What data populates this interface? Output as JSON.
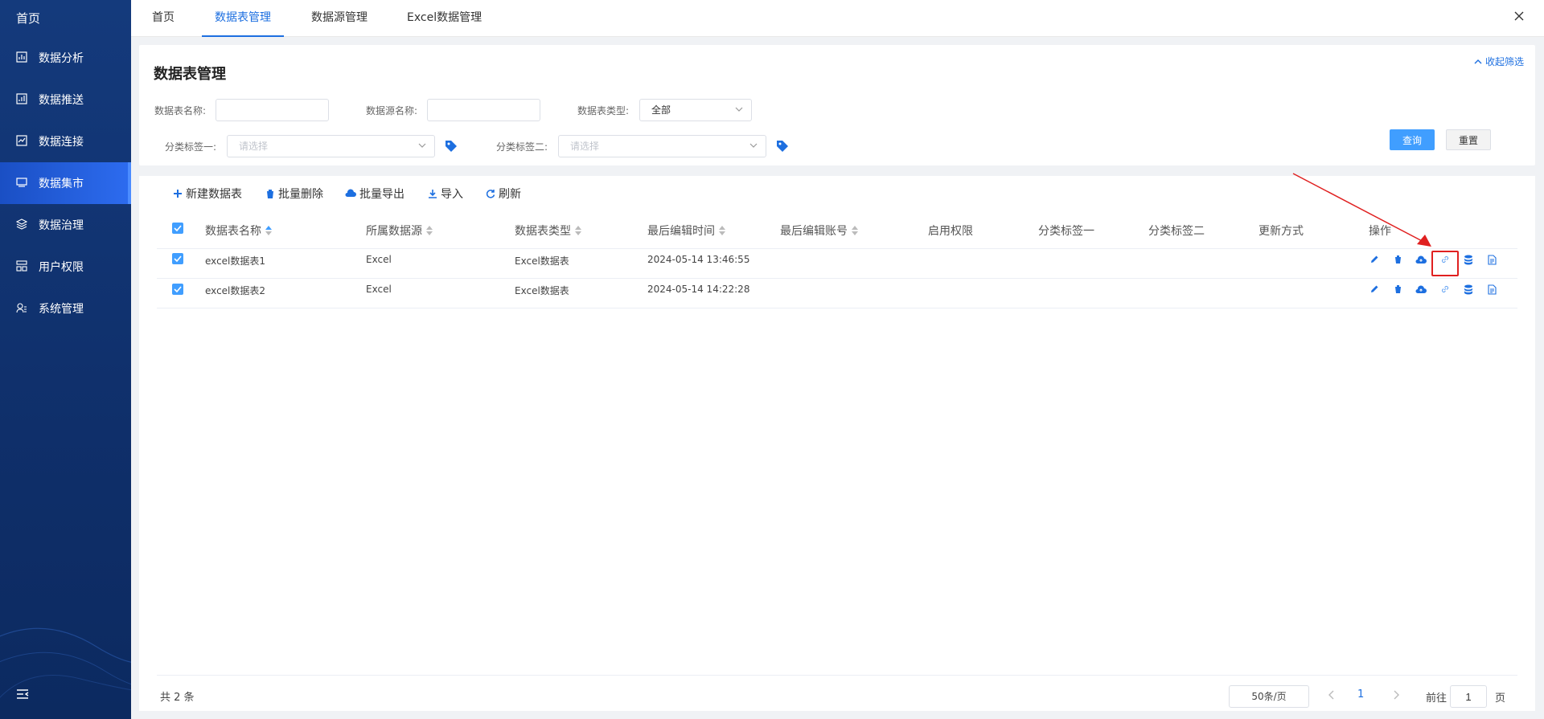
{
  "sidebar": {
    "home": "首页",
    "items": [
      {
        "label": "数据分析",
        "icon": "chart-icon"
      },
      {
        "label": "数据推送",
        "icon": "push-icon"
      },
      {
        "label": "数据连接",
        "icon": "connect-icon"
      },
      {
        "label": "数据集市",
        "icon": "monitor-icon",
        "active": true
      },
      {
        "label": "数据治理",
        "icon": "layers-icon"
      },
      {
        "label": "用户权限",
        "icon": "user-permission-icon"
      },
      {
        "label": "系统管理",
        "icon": "settings-icon"
      }
    ],
    "toggle_icon": "menu-collapse-icon"
  },
  "tabs": [
    {
      "label": "首页"
    },
    {
      "label": "数据表管理",
      "active": true
    },
    {
      "label": "数据源管理"
    },
    {
      "label": "Excel数据管理"
    }
  ],
  "filter": {
    "title": "数据表管理",
    "collapse_label": "收起筛选",
    "table_name_label": "数据表名称:",
    "table_name_value": "",
    "source_name_label": "数据源名称:",
    "source_name_value": "",
    "table_type_label": "数据表类型:",
    "table_type_value": "全部",
    "tag1_label": "分类标签一:",
    "tag1_placeholder": "请选择",
    "tag2_label": "分类标签二:",
    "tag2_placeholder": "请选择",
    "query_button": "查询",
    "reset_button": "重置"
  },
  "toolbar": {
    "new_table": "新建数据表",
    "batch_delete": "批量删除",
    "batch_export": "批量导出",
    "import": "导入",
    "refresh": "刷新"
  },
  "table": {
    "columns": [
      "数据表名称",
      "所属数据源",
      "数据表类型",
      "最后编辑时间",
      "最后编辑账号",
      "启用权限",
      "分类标签一",
      "分类标签二",
      "更新方式",
      "操作"
    ],
    "rows": [
      {
        "name": "excel数据表1",
        "source": "Excel",
        "type": "Excel数据表",
        "edit_time": "2024-05-14 13:46:55",
        "account": "",
        "permission": "",
        "tag1": "",
        "tag2": "",
        "update": ""
      },
      {
        "name": "excel数据表2",
        "source": "Excel",
        "type": "Excel数据表",
        "edit_time": "2024-05-14 14:22:28",
        "account": "",
        "permission": "",
        "tag1": "",
        "tag2": "",
        "update": ""
      }
    ],
    "action_icons": [
      "edit-icon",
      "delete-icon",
      "cloud-upload-icon",
      "link-icon",
      "database-icon",
      "document-icon"
    ]
  },
  "pagination": {
    "total": "共 2 条",
    "page_size": "50条/页",
    "current_page": "1",
    "goto_prefix": "前往",
    "goto_value": "1",
    "goto_suffix": "页"
  },
  "colors": {
    "sidebar_bg": "#143a7c",
    "accent": "#1d6fe0",
    "primary_button": "#409eff",
    "annotation_red": "#e02020"
  }
}
